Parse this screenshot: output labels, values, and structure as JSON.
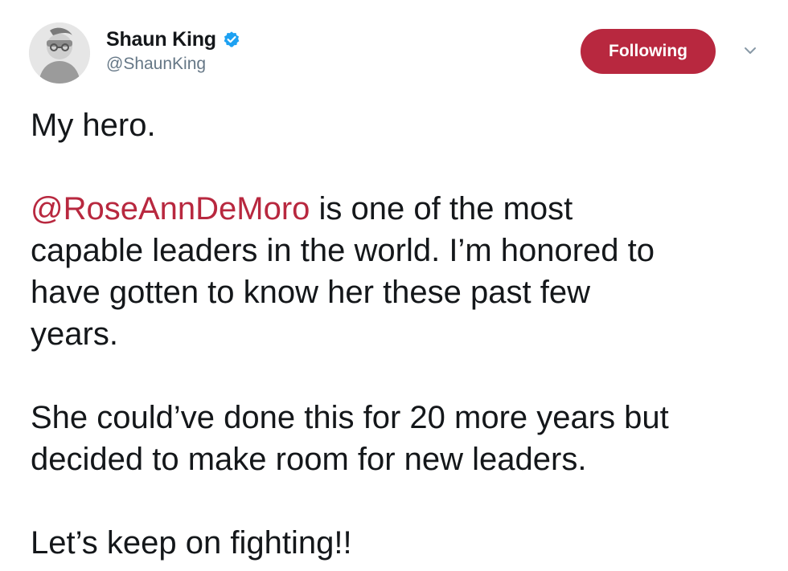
{
  "author": {
    "display_name": "Shaun King",
    "handle": "@ShaunKing",
    "verified": true,
    "avatar_icon": "user-avatar-photo"
  },
  "actions": {
    "follow_label": "Following",
    "menu_icon": "chevron-down-icon"
  },
  "tweet": {
    "p1": "My hero.",
    "p2_mention": "@RoseAnnDeMoro",
    "p2_line1_rest": " is one of the most",
    "p2_line2": "capable leaders in the world. I’m honored to",
    "p2_line3": "have gotten to know her these past few",
    "p2_line4": "years.",
    "p3_line1": "She could’ve done this for 20 more years but",
    "p3_line2": "decided to make room for new leaders.",
    "p4": "Let’s keep on fighting!!"
  },
  "colors": {
    "accent": "#b8283f",
    "verified_blue": "#1da1f2",
    "handle_gray": "#657786",
    "text": "#14171a"
  }
}
